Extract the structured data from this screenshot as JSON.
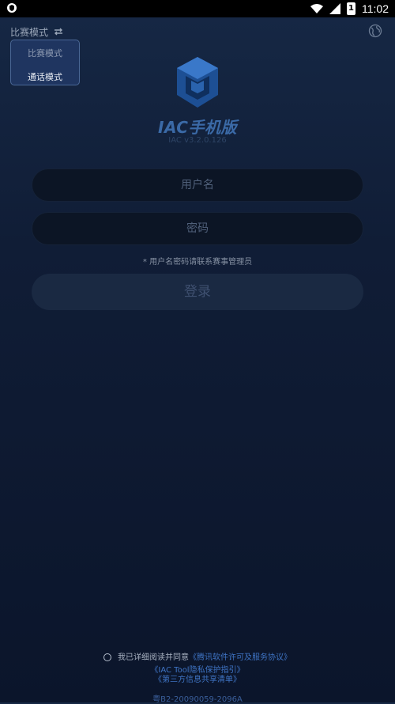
{
  "status_bar": {
    "time": "11:02",
    "battery_level": "1",
    "icons": [
      "shield-icon",
      "wifi-icon",
      "signal-icon",
      "battery-icon"
    ]
  },
  "mode_switch": {
    "label": "比赛模式",
    "icon": "swap-icon"
  },
  "mode_menu": {
    "items": [
      "比赛模式",
      "通话模式"
    ]
  },
  "header_icon": "globe-icon",
  "app": {
    "title": "IAC手机版",
    "version": "IAC v3.2.0.126"
  },
  "form": {
    "username_placeholder": "用户名",
    "password_placeholder": "密码",
    "hint": "* 用户名密码请联系赛事管理员",
    "login_label": "登录"
  },
  "agreement": {
    "prefix": "我已详细阅读并同意",
    "link1": "《腾讯软件许可及服务协议》",
    "link2": "《IAC Tool隐私保护指引》",
    "link3": "《第三方信息共享清单》"
  },
  "license": "粤B2-20090059-2096A",
  "colors": {
    "background": "#101d36",
    "accent": "#3f74c4",
    "menu_background": "#1f3560"
  }
}
